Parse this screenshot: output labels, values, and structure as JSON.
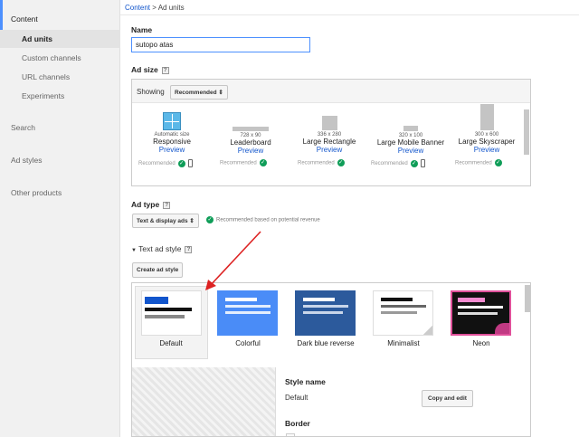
{
  "sidebar": {
    "content": "Content",
    "items": [
      {
        "label": "Ad units"
      },
      {
        "label": "Custom channels"
      },
      {
        "label": "URL channels"
      },
      {
        "label": "Experiments"
      }
    ],
    "search": "Search",
    "ad_styles": "Ad styles",
    "other_products": "Other products"
  },
  "breadcrumb": {
    "root": "Content",
    "sep": " > ",
    "current": "Ad units"
  },
  "name": {
    "label": "Name",
    "value": "sutopo atas"
  },
  "ad_size": {
    "label": "Ad size",
    "showing_label": "Showing",
    "showing_value": "Recommended",
    "sizes": [
      {
        "dim": "Automatic size",
        "name": "Responsive",
        "preview": "Preview",
        "rec": "Recommended"
      },
      {
        "dim": "728 x 90",
        "name": "Leaderboard",
        "preview": "Preview",
        "rec": "Recommended"
      },
      {
        "dim": "336 x 280",
        "name": "Large Rectangle",
        "preview": "Preview",
        "rec": "Recommended"
      },
      {
        "dim": "320 x 100",
        "name": "Large Mobile Banner",
        "preview": "Preview",
        "rec": "Recommended"
      },
      {
        "dim": "300 x 600",
        "name": "Large Skyscraper",
        "preview": "Preview",
        "rec": "Recommended"
      }
    ]
  },
  "ad_type": {
    "label": "Ad type",
    "value": "Text & display ads",
    "note": "Recommended based on potential revenue"
  },
  "text_ad_style": {
    "label": "Text ad style",
    "create_button": "Create ad style",
    "styles": [
      {
        "name": "Default"
      },
      {
        "name": "Colorful"
      },
      {
        "name": "Dark blue reverse"
      },
      {
        "name": "Minimalist"
      },
      {
        "name": "Neon"
      }
    ],
    "style_name_label": "Style name",
    "style_name_value": "Default",
    "copy_edit_button": "Copy and edit",
    "border_label": "Border"
  },
  "colors": {
    "accent": "#4d90fe",
    "link": "#1155cc",
    "check": "#0f9d58",
    "arrow": "#dd2222"
  }
}
